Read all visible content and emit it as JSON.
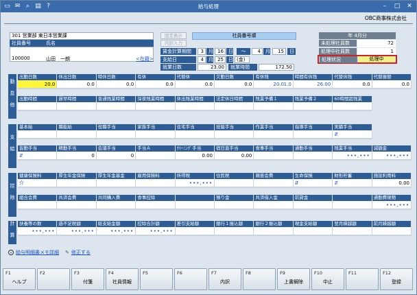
{
  "window": {
    "title": "給与処理",
    "company": "OBC商事株式会社"
  },
  "employee": {
    "dept": "301 営業部 東日本営業課",
    "col_code": "社員番号",
    "col_name": "氏名",
    "code": "100000",
    "name": "山田　一朗",
    "status_link": "<在籍>",
    "btn_fixed": "固定表示",
    "btn_input": "内訳入力",
    "select_label": "社員番号順"
  },
  "period": {
    "calc_label": "賃金計算期間",
    "from_m": "3",
    "月1": "月",
    "from_d": "16",
    "日1": "日",
    "tilde": "～",
    "to_m": "4",
    "月2": "月",
    "to_d": "15",
    "日2": "日",
    "pay_label": "支給日",
    "pay_m": "4",
    "月3": "月",
    "pay_d": "25",
    "日3": "日",
    "pay_wd": "(金)",
    "work_days_label": "就業日数",
    "work_days": "23.00",
    "work_hours_label": "就業時間",
    "work_hours": "172.50"
  },
  "summary": {
    "month": "年 4月分",
    "unprocessed_label": "未処理社員数",
    "unprocessed": "72",
    "processing_label": "処理中社員数",
    "processing": "1",
    "state_label": "処理状況",
    "state": "処理中"
  },
  "attendance": {
    "side": "勤怠他",
    "row1_headers": [
      "出勤日数",
      "休出日数",
      "特休日数",
      "有休",
      "代替休",
      "欠勤日数",
      "有休残",
      "時間有休残",
      "代替休残",
      "代替振替"
    ],
    "row1_values": [
      "20.0",
      "0.0",
      "0.0",
      "0.0",
      "0.0",
      "0.0",
      "1.0",
      "26.00",
      "0.0",
      "0.0"
    ],
    "row1_extra": [
      "",
      "",
      "",
      "",
      "",
      "",
      "20.0",
      "",
      "",
      ""
    ],
    "row2_headers": [
      "出勤時間",
      "遅早時間",
      "普通残業時間",
      "深夜残業時間",
      "休出残業時間",
      "法定休日時間",
      "残業予備１",
      "残業予備２",
      "60時間超残業"
    ],
    "row2_values": [
      "",
      "",
      "",
      "",
      "",
      "",
      "",
      "",
      ""
    ]
  },
  "payment": {
    "side": "支給",
    "row1_headers": [
      "基本給",
      "職能給",
      "役職手当",
      "家族手当",
      "住宅手当",
      "技能手当",
      "作業手当",
      "指導手当",
      "実績手当"
    ],
    "row1_values": [
      "",
      "",
      "",
      "",
      "",
      "",
      "",
      "",
      "⇵"
    ],
    "row2_headers": [
      "皆勤手当",
      "精勤手当",
      "会議手当",
      "手当Ａ",
      "ｸﾘｰﾆﾝｸﾞ手当",
      "宿日直手当",
      "食事手当",
      "通勤手当",
      "残業手当",
      "減額金"
    ],
    "row2_values": [
      "⇵",
      "0",
      "0",
      "",
      "0.00",
      "0.00",
      "",
      "",
      "•••,•••",
      "•••,•••"
    ]
  },
  "deduction": {
    "side": "控除",
    "row1_headers": [
      "健康保険料",
      "厚生年金保険",
      "厚生年金基金",
      "雇用保険料",
      "所得税",
      "住民税",
      "親善会費",
      "生命保険",
      "財形貯蓄",
      "施設利用料"
    ],
    "row1_values": [
      "介",
      "",
      "",
      "",
      "•••,•••",
      "",
      "",
      "⇵",
      "⇵",
      "0.00"
    ],
    "row2_headers": [
      "組合会費",
      "共済会費",
      "共同購入費",
      "食事控除",
      "",
      "預り金",
      "共済借入金",
      "前貸金",
      "",
      "通勤費現物"
    ],
    "row2_values": [
      "",
      "",
      "",
      "",
      "",
      "",
      "",
      "",
      "",
      "•••,•••"
    ]
  },
  "totals": {
    "side": "計算",
    "headers": [
      "扶養等の数",
      "過不足税額",
      "総支給金額",
      "控除合計額",
      "差引支給額",
      "銀行１振込額",
      "銀行２振込額",
      "現金支給額",
      "翌月繰越額",
      "前月繰越額"
    ],
    "values": [
      "•••,•••",
      "•••,•••",
      "•••,•••",
      "•••,•••",
      "",
      "",
      "",
      "",
      "",
      ""
    ]
  },
  "links": {
    "memo": "給与明細書メモ詳細",
    "edit": "修正する"
  },
  "fkeys": [
    {
      "n": "F1",
      "l": "ヘルプ"
    },
    {
      "n": "F2",
      "l": ""
    },
    {
      "n": "F3",
      "l": "付箋"
    },
    {
      "n": "F4",
      "l": "社員情報"
    },
    {
      "n": "F5",
      "l": ""
    },
    {
      "n": "F6",
      "l": ""
    },
    {
      "n": "F7",
      "l": "内訳"
    },
    {
      "n": "F8",
      "l": ""
    },
    {
      "n": "F9",
      "l": "上書解除"
    },
    {
      "n": "F10",
      "l": "中止"
    },
    {
      "n": "F11",
      "l": ""
    },
    {
      "n": "F12",
      "l": "登録"
    }
  ]
}
